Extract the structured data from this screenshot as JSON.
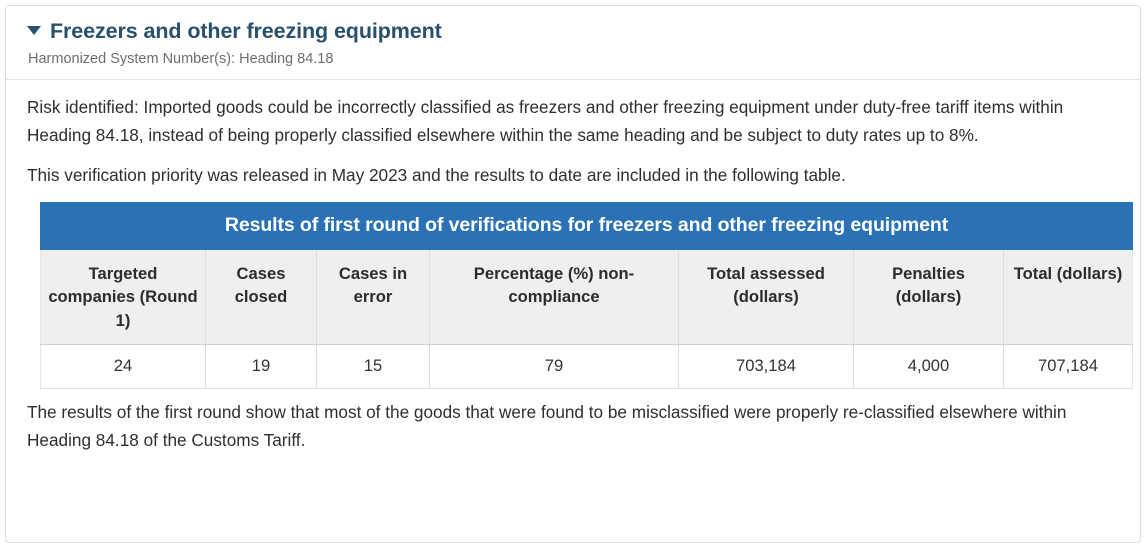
{
  "section": {
    "caret_icon": "caret-down-icon",
    "title": "Freezers and other freezing equipment",
    "subtitle": "Harmonized System Number(s): Heading 84.18"
  },
  "body": {
    "risk_paragraph": "Risk identified: Imported goods could be incorrectly classified as freezers and other freezing equipment under duty-free tariff items within Heading 84.18, instead of being properly classified elsewhere within the same heading and be subject to duty rates up to 8%.",
    "release_paragraph": "This verification priority was released in May 2023 and the results to date are included in the following table.",
    "conclusion_paragraph": "The results of the first round show that most of the goods that were found to be misclassified were properly re-classified elsewhere within Heading 84.18 of the Customs Tariff."
  },
  "table": {
    "caption": "Results of first round of verifications for freezers and other freezing equipment",
    "headers": [
      "Targeted companies (Round 1)",
      "Cases closed",
      "Cases in error",
      "Percentage (%) non-compliance",
      "Total assessed (dollars)",
      "Penalties (dollars)",
      "Total (dollars)"
    ],
    "rows": [
      [
        "24",
        "19",
        "15",
        "79",
        "703,184",
        "4,000",
        "707,184"
      ]
    ]
  },
  "colors": {
    "caption_background": "#2a72b5",
    "header_background": "#efefef",
    "title_text": "#29506d",
    "subtitle_text": "#6e6e6e",
    "body_text": "#2f2f2f",
    "card_border": "#dedede"
  }
}
